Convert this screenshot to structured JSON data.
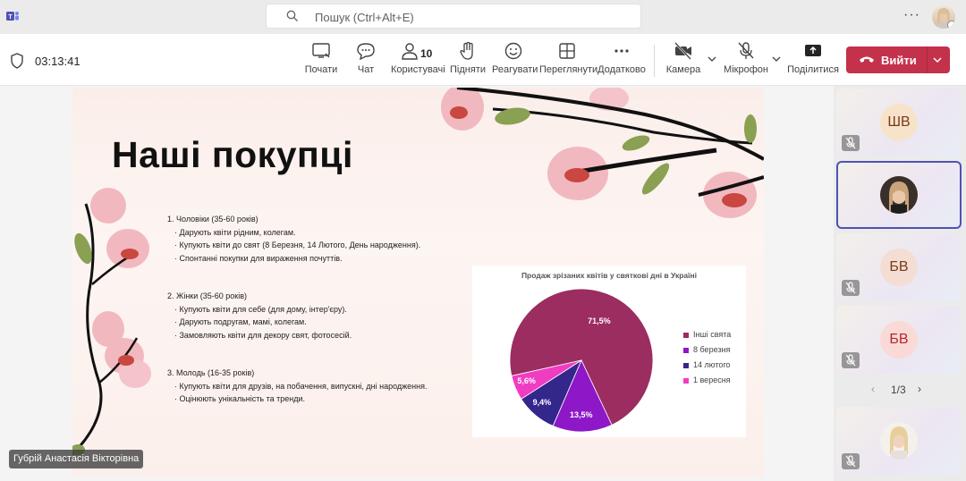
{
  "search": {
    "placeholder": "Пошук (Ctrl+Alt+E)"
  },
  "meeting": {
    "timer": "03:13:41"
  },
  "toolbar": {
    "people_count": "10",
    "buttons": [
      {
        "label": "Почати"
      },
      {
        "label": "Чат"
      },
      {
        "label": "Користувачі"
      },
      {
        "label": "Підняти"
      },
      {
        "label": "Реагувати"
      },
      {
        "label": "Переглянути"
      },
      {
        "label": "Додатково"
      },
      {
        "label": "Камера"
      },
      {
        "label": "Мікрофон"
      },
      {
        "label": "Поділитися"
      }
    ],
    "leave_label": "Вийти"
  },
  "colors": {
    "accent": "#4f52b2",
    "leave": "#c4314b"
  },
  "slide": {
    "title": "Наші покупці",
    "sections": [
      {
        "heading": "1. Чоловіки (35-60 років)",
        "items": [
          "· Дарують квіти рідним, колегам.",
          "· Купують квіти до свят (8 Березня, 14 Лютого, День народження).",
          "· Спонтанні покупки для вираження почуттів."
        ]
      },
      {
        "heading": "2. Жінки (35-60 років)",
        "items": [
          "· Купують квіти для себе (для дому, інтер'єру).",
          "· Дарують подругам, мамі, колегам.",
          "· Замовляють квіти для декору свят, фотосесій."
        ]
      },
      {
        "heading": "3. Молодь (16-35 років)",
        "items": [
          "· Купують квіти для друзів, на побачення, випускні, дні народження.",
          "· Оцінюють унікальність та тренди."
        ]
      }
    ]
  },
  "chart_data": {
    "type": "pie",
    "title": "Продаж зрізаних квітів у святкові дні в Україні",
    "categories": [
      "Інші свята",
      "8 березня",
      "14 лютого",
      "1 вересня"
    ],
    "values": [
      71.5,
      13.5,
      9.4,
      5.6
    ],
    "labels": [
      "71,5%",
      "13,5%",
      "9,4%",
      "5,6%"
    ],
    "colors": [
      "#9b2d60",
      "#8e17c8",
      "#33278c",
      "#f03cc2"
    ],
    "legend_position": "right"
  },
  "presenter": {
    "name": "Губрій Анастасія Вікторівна"
  },
  "participants": [
    {
      "initials": "ШВ"
    },
    {
      "initials": ""
    },
    {
      "initials": "БВ"
    },
    {
      "initials": "БВ"
    },
    {
      "initials": ""
    }
  ],
  "pager": {
    "text": "1/3"
  }
}
